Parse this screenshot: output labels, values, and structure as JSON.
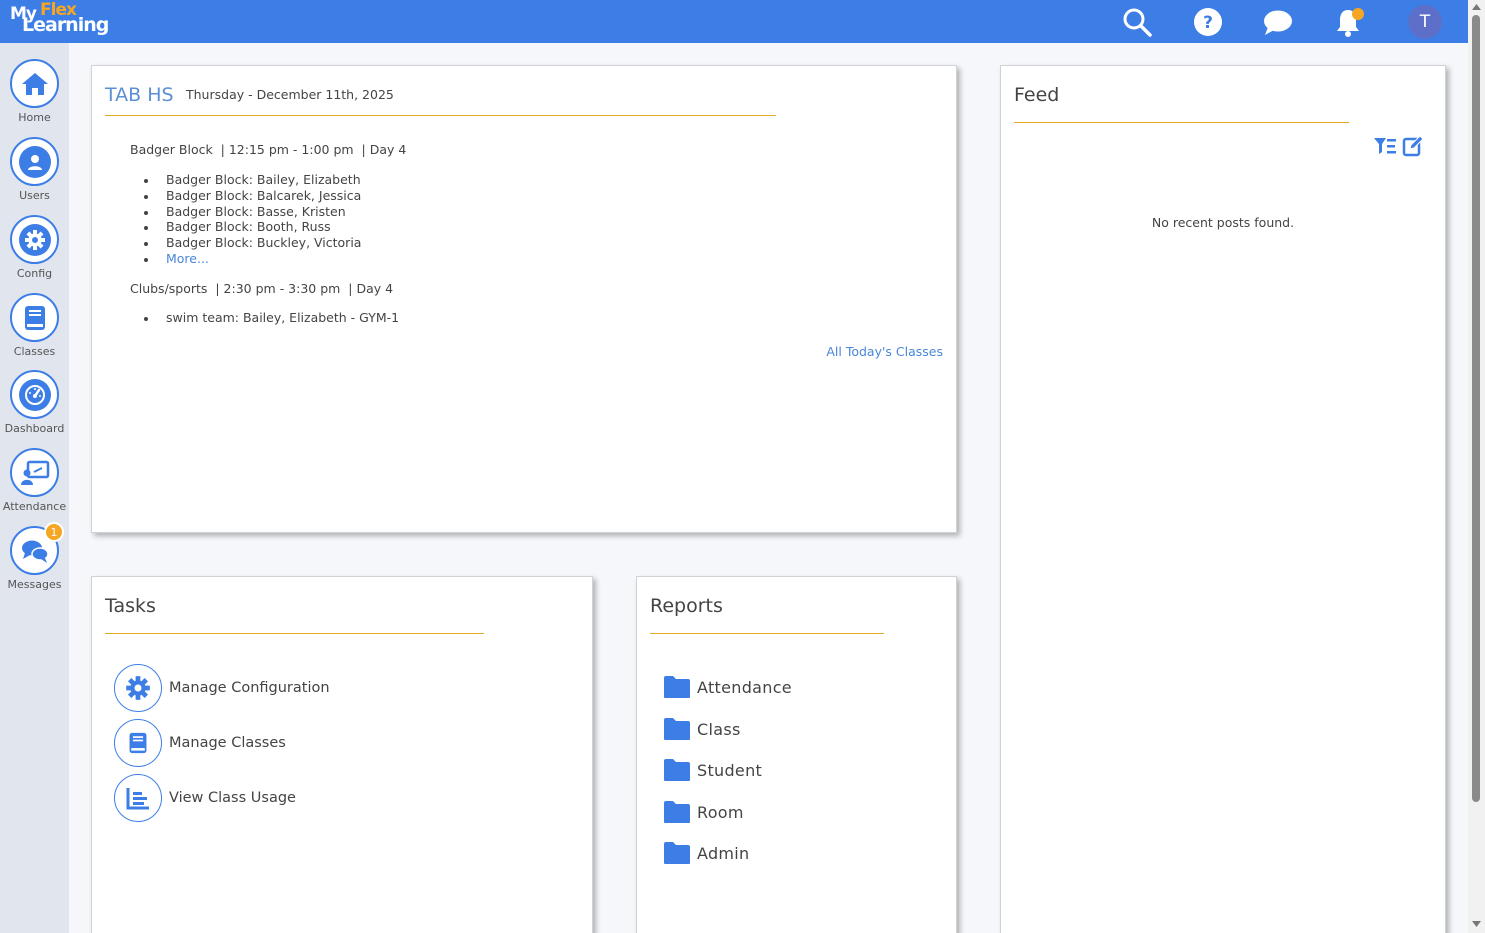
{
  "logo": {
    "my": "My",
    "flex": "Flex",
    "learning": "Learning"
  },
  "topbar": {
    "icons": [
      "search-icon",
      "help-icon",
      "chat-icon",
      "bell-icon"
    ],
    "avatar_initial": "T"
  },
  "sidebar": {
    "items": [
      {
        "label": "Home",
        "icon": "home-icon"
      },
      {
        "label": "Users",
        "icon": "user-icon"
      },
      {
        "label": "Config",
        "icon": "gear-icon"
      },
      {
        "label": "Classes",
        "icon": "book-icon"
      },
      {
        "label": "Dashboard",
        "icon": "gauge-icon"
      },
      {
        "label": "Attendance",
        "icon": "presenter-icon"
      },
      {
        "label": "Messages",
        "icon": "messages-icon",
        "badge": "1"
      }
    ]
  },
  "schedule": {
    "school": "TAB HS",
    "date": "Thursday - December 11th, 2025",
    "blocks": [
      {
        "header": "Badger Block  | 12:15 pm - 1:00 pm  | Day 4",
        "items": [
          "Badger Block: Bailey, Elizabeth",
          "Badger Block: Balcarek, Jessica",
          "Badger Block: Basse, Kristen",
          "Badger Block: Booth, Russ",
          "Badger Block: Buckley, Victoria"
        ],
        "more": "More..."
      },
      {
        "header": "Clubs/sports  | 2:30 pm - 3:30 pm  | Day 4",
        "items": [
          "swim team: Bailey, Elizabeth - GYM-1"
        ]
      }
    ],
    "all_link": "All Today's Classes"
  },
  "tasks": {
    "title": "Tasks",
    "items": [
      {
        "label": "Manage Configuration",
        "icon": "gear-icon"
      },
      {
        "label": "Manage Classes",
        "icon": "book-icon"
      },
      {
        "label": "View Class Usage",
        "icon": "usage-chart-icon"
      }
    ]
  },
  "reports": {
    "title": "Reports",
    "items": [
      "Attendance",
      "Class",
      "Student",
      "Room",
      "Admin"
    ]
  },
  "feed": {
    "title": "Feed",
    "empty": "No recent posts found."
  },
  "colors": {
    "primary": "#3d7ee6",
    "accent": "#e5a825",
    "link": "#4a86d8"
  }
}
